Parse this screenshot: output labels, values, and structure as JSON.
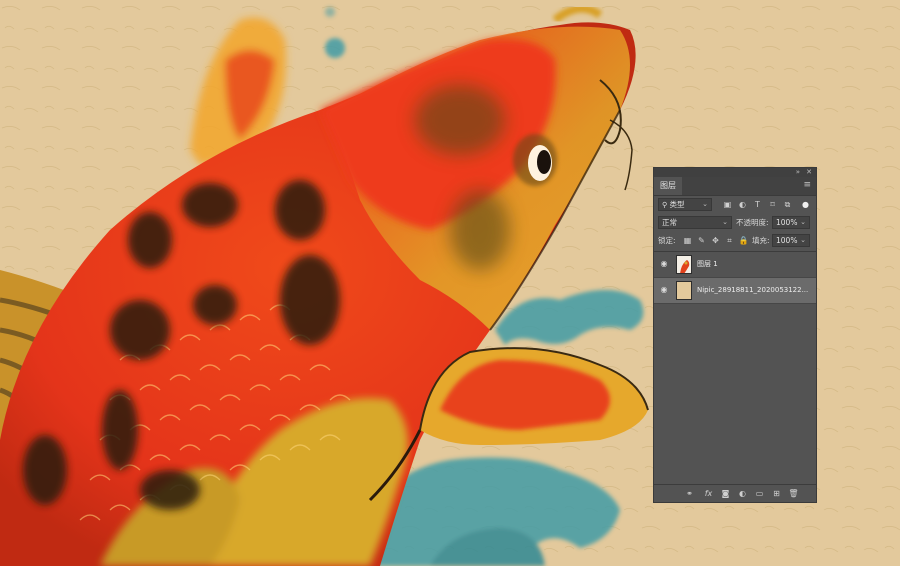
{
  "canvas": {
    "image": "koi-fish-painting",
    "background_color": "#e3c99c"
  },
  "panel": {
    "title": "图层",
    "collapse_icon": "double-chevron-icon",
    "close_icon": "close-icon",
    "filter": {
      "label": "类型",
      "icon": "search-icon"
    },
    "filter_icons": [
      "image-filter-icon",
      "adjustment-filter-icon",
      "text-filter-icon",
      "shape-filter-icon",
      "smart-object-filter-icon",
      "filter-toggle-icon"
    ],
    "blend_mode": "正常",
    "opacity": {
      "label": "不透明度:",
      "value": "100%"
    },
    "lock": {
      "label": "锁定:",
      "icons": [
        "lock-transparent-icon",
        "lock-image-icon",
        "lock-position-icon",
        "lock-artboard-icon",
        "lock-all-icon"
      ]
    },
    "fill": {
      "label": "填充:",
      "value": "100%"
    },
    "layers": [
      {
        "name": "图层 1",
        "visible": true,
        "selected": false
      },
      {
        "name": "Nipic_28918811_2020053122...",
        "visible": true,
        "selected": true
      }
    ],
    "footer_icons": [
      "link-layers-icon",
      "fx-icon",
      "add-mask-icon",
      "adjustment-layer-icon",
      "new-group-icon",
      "new-layer-icon",
      "delete-icon"
    ]
  }
}
